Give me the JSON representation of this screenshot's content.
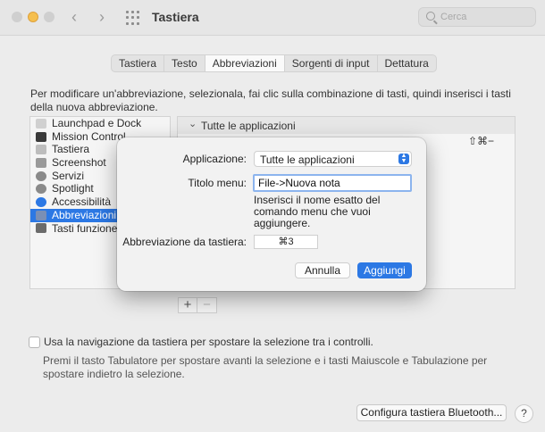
{
  "window": {
    "title": "Tastiera"
  },
  "search": {
    "placeholder": "Cerca"
  },
  "tabs": [
    {
      "label": "Tastiera"
    },
    {
      "label": "Testo"
    },
    {
      "label": "Abbreviazioni"
    },
    {
      "label": "Sorgenti di input"
    },
    {
      "label": "Dettatura"
    }
  ],
  "description": "Per modificare un'abbreviazione, selezionala, fai clic sulla combinazione di tasti, quindi inserisci i tasti della nuova abbreviazione.",
  "sidebar": {
    "items": [
      {
        "label": "Launchpad e Dock",
        "icon": "launchpad-icon",
        "color": "#d0d0d0"
      },
      {
        "label": "Mission Control",
        "icon": "mission-control-icon",
        "color": "#3a3a3a"
      },
      {
        "label": "Tastiera",
        "icon": "keyboard-icon",
        "color": "#bdbdbd"
      },
      {
        "label": "Screenshot",
        "icon": "screenshot-icon",
        "color": "#9a9a9a"
      },
      {
        "label": "Servizi",
        "icon": "gear-icon",
        "color": "#8a8a8a"
      },
      {
        "label": "Spotlight",
        "icon": "spotlight-icon",
        "color": "#8a8a8a"
      },
      {
        "label": "Accessibilità",
        "icon": "accessibility-icon",
        "color": "#2c78e4"
      },
      {
        "label": "Abbreviazioni a",
        "icon": "app-shortcuts-icon",
        "color": "#7a8fb5"
      },
      {
        "label": "Tasti funzione",
        "icon": "fn-key-icon",
        "color": "#6b6b6b"
      }
    ]
  },
  "shortcut_list": {
    "group": "Tutte le applicazioni",
    "shortcut": "⇧⌘−"
  },
  "dialog": {
    "application_label": "Applicazione:",
    "application_value": "Tutte le applicazioni",
    "menu_title_label": "Titolo menu:",
    "menu_title_value": "File->Nuova nota",
    "menu_title_hint": "Inserisci il nome esatto del comando menu che vuoi aggiungere.",
    "shortcut_label": "Abbreviazione da tastiera:",
    "shortcut_value": "⌘3",
    "cancel_label": "Annulla",
    "add_label": "Aggiungi"
  },
  "controls": {
    "add_label": "+",
    "remove_label": "−"
  },
  "keyboard_nav": {
    "label": "Usa la navigazione da tastiera per spostare la selezione tra i controlli.",
    "hint": "Premi il tasto Tabulatore per spostare avanti la selezione e i tasti Maiuscole e Tabulazione per spostare indietro la selezione."
  },
  "footer": {
    "bluetooth_button": "Configura tastiera Bluetooth...",
    "help_button": "?"
  },
  "colors": {
    "accent": "#2c78e4"
  }
}
